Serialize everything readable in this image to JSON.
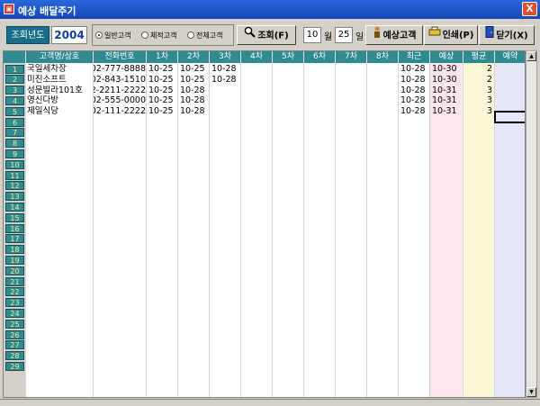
{
  "window": {
    "title": "예상 배달주기",
    "close": "X"
  },
  "toolbar": {
    "year_label": "조회년도",
    "year_value": "2004",
    "radios": [
      {
        "label": "일반고객",
        "checked": true
      },
      {
        "label": "체적고객",
        "checked": false
      },
      {
        "label": "전체고객",
        "checked": false
      }
    ],
    "search_label": "조회(F)",
    "month_value": "10",
    "month_unit": "월",
    "day_value": "25",
    "day_unit": "일",
    "expected_label": "예상고객",
    "print_label": "인쇄(P)",
    "close_label": "닫기(X)"
  },
  "grid": {
    "columns": [
      "고객명/상호",
      "전화번호",
      "1차",
      "2차",
      "3차",
      "4차",
      "5차",
      "6차",
      "7차",
      "8차",
      "최근",
      "예상",
      "평균",
      "예약"
    ],
    "rows": [
      [
        "국일세차장",
        "02-777-8888",
        "10-25",
        "10-25",
        "10-28",
        "",
        "",
        "",
        "",
        "",
        "10-28",
        "10-30",
        "2",
        ""
      ],
      [
        "미진소프트",
        "02-843-1510",
        "10-25",
        "10-25",
        "10-28",
        "",
        "",
        "",
        "",
        "",
        "10-28",
        "10-30",
        "2",
        ""
      ],
      [
        "성문빌라101호",
        "02-2211-2222",
        "10-25",
        "10-28",
        "",
        "",
        "",
        "",
        "",
        "",
        "10-28",
        "10-31",
        "3",
        ""
      ],
      [
        "영신다방",
        "02-555-0000",
        "10-25",
        "10-28",
        "",
        "",
        "",
        "",
        "",
        "",
        "10-28",
        "10-31",
        "3",
        ""
      ],
      [
        "제일식당",
        "02-111-2222",
        "10-25",
        "10-28",
        "",
        "",
        "",
        "",
        "",
        "",
        "10-28",
        "10-31",
        "3",
        ""
      ]
    ],
    "row_numbers": [
      "1",
      "2",
      "3",
      "4",
      "5",
      "6",
      "7",
      "8",
      "9",
      "10",
      "11",
      "12",
      "13",
      "14",
      "15",
      "16",
      "17",
      "18",
      "19",
      "20",
      "21",
      "22",
      "23",
      "24",
      "25",
      "26",
      "27",
      "28",
      "29"
    ]
  },
  "colors": {
    "header_bg": "#2f8a92",
    "trend_col": "#fde6ee",
    "avg_col": "#fbf8d8",
    "rsv_col": "#e6e6fb"
  }
}
